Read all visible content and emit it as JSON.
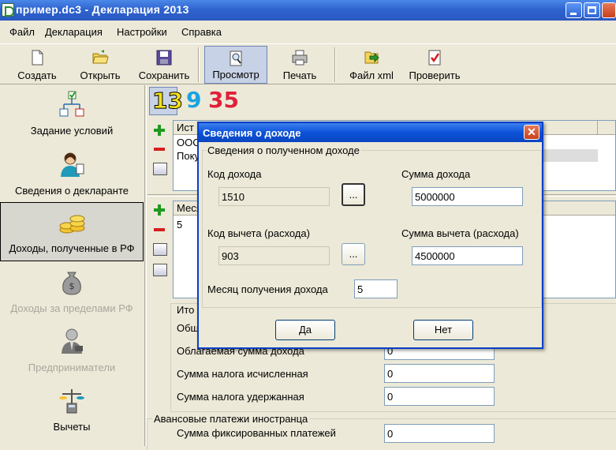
{
  "window": {
    "title": "пример.dc3 - Декларация 2013"
  },
  "menu": [
    "Файл",
    "Декларация",
    "Настройки",
    "Справка"
  ],
  "toolbar": [
    {
      "label": "Создать",
      "icon": "new-document-icon"
    },
    {
      "label": "Открыть",
      "icon": "open-folder-icon"
    },
    {
      "label": "Сохранить",
      "icon": "floppy-disk-icon"
    },
    {
      "label": "Просмотр",
      "icon": "preview-icon"
    },
    {
      "label": "Печать",
      "icon": "printer-icon"
    },
    {
      "label": "Файл xml",
      "icon": "xml-export-icon"
    },
    {
      "label": "Проверить",
      "icon": "check-document-icon"
    }
  ],
  "nav": [
    {
      "label": "Задание условий",
      "icon": "conditions-tree-icon"
    },
    {
      "label": "Сведения о декларанте",
      "icon": "person-icon"
    },
    {
      "label": "Доходы, полученные в РФ",
      "icon": "coins-icon"
    },
    {
      "label": "Доходы за пределами РФ",
      "icon": "money-bag-icon"
    },
    {
      "label": "Предприниматели",
      "icon": "businessman-icon"
    },
    {
      "label": "Вычеты",
      "icon": "scales-calculator-icon"
    }
  ],
  "rates": [
    "13",
    "9",
    "35"
  ],
  "colors": {
    "rate13": "#f2e21a",
    "rate9": "#1aa3e0",
    "rate35": "#e0203a",
    "title_bar": "#2f64cf"
  },
  "top_grid": {
    "header": "Ист",
    "rows": [
      "ООС",
      "Поку"
    ]
  },
  "month_grid": {
    "header": "Меся",
    "rows": [
      "5"
    ]
  },
  "totals": {
    "group_title": "Ито",
    "row1_label": "Общ",
    "taxable_label": "Облагаемая сумма дохода",
    "taxable_value": "0",
    "calc_label": "Сумма налога исчисленная",
    "calc_value": "0",
    "withheld_label": "Сумма налога удержанная",
    "withheld_value": "0"
  },
  "advance": {
    "group_title": "Авансовые платежи иностранца",
    "fixed_label": "Сумма фиксированных платежей",
    "fixed_value": "0"
  },
  "dialog": {
    "title": "Сведения о доходе",
    "group_title": "Сведения о полученном доходе",
    "income_code_label": "Код дохода",
    "income_code_value": "1510",
    "income_sum_label": "Сумма дохода",
    "income_sum_value": "5000000",
    "deduction_code_label": "Код вычета (расхода)",
    "deduction_code_value": "903",
    "deduction_sum_label": "Сумма вычета (расхода)",
    "deduction_sum_value": "4500000",
    "month_label": "Месяц получения дохода",
    "month_value": "5",
    "browse_label": "...",
    "ok_label": "Да",
    "cancel_label": "Нет"
  }
}
